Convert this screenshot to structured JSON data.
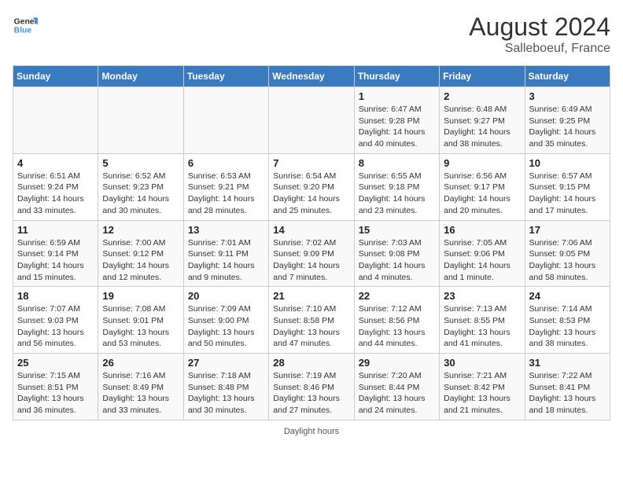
{
  "header": {
    "logo_general": "General",
    "logo_blue": "Blue",
    "month_year": "August 2024",
    "location": "Salleboeuf, France"
  },
  "days_of_week": [
    "Sunday",
    "Monday",
    "Tuesday",
    "Wednesday",
    "Thursday",
    "Friday",
    "Saturday"
  ],
  "weeks": [
    [
      {
        "day": "",
        "info": ""
      },
      {
        "day": "",
        "info": ""
      },
      {
        "day": "",
        "info": ""
      },
      {
        "day": "",
        "info": ""
      },
      {
        "day": "1",
        "info": "Sunrise: 6:47 AM\nSunset: 9:28 PM\nDaylight: 14 hours\nand 40 minutes."
      },
      {
        "day": "2",
        "info": "Sunrise: 6:48 AM\nSunset: 9:27 PM\nDaylight: 14 hours\nand 38 minutes."
      },
      {
        "day": "3",
        "info": "Sunrise: 6:49 AM\nSunset: 9:25 PM\nDaylight: 14 hours\nand 35 minutes."
      }
    ],
    [
      {
        "day": "4",
        "info": "Sunrise: 6:51 AM\nSunset: 9:24 PM\nDaylight: 14 hours\nand 33 minutes."
      },
      {
        "day": "5",
        "info": "Sunrise: 6:52 AM\nSunset: 9:23 PM\nDaylight: 14 hours\nand 30 minutes."
      },
      {
        "day": "6",
        "info": "Sunrise: 6:53 AM\nSunset: 9:21 PM\nDaylight: 14 hours\nand 28 minutes."
      },
      {
        "day": "7",
        "info": "Sunrise: 6:54 AM\nSunset: 9:20 PM\nDaylight: 14 hours\nand 25 minutes."
      },
      {
        "day": "8",
        "info": "Sunrise: 6:55 AM\nSunset: 9:18 PM\nDaylight: 14 hours\nand 23 minutes."
      },
      {
        "day": "9",
        "info": "Sunrise: 6:56 AM\nSunset: 9:17 PM\nDaylight: 14 hours\nand 20 minutes."
      },
      {
        "day": "10",
        "info": "Sunrise: 6:57 AM\nSunset: 9:15 PM\nDaylight: 14 hours\nand 17 minutes."
      }
    ],
    [
      {
        "day": "11",
        "info": "Sunrise: 6:59 AM\nSunset: 9:14 PM\nDaylight: 14 hours\nand 15 minutes."
      },
      {
        "day": "12",
        "info": "Sunrise: 7:00 AM\nSunset: 9:12 PM\nDaylight: 14 hours\nand 12 minutes."
      },
      {
        "day": "13",
        "info": "Sunrise: 7:01 AM\nSunset: 9:11 PM\nDaylight: 14 hours\nand 9 minutes."
      },
      {
        "day": "14",
        "info": "Sunrise: 7:02 AM\nSunset: 9:09 PM\nDaylight: 14 hours\nand 7 minutes."
      },
      {
        "day": "15",
        "info": "Sunrise: 7:03 AM\nSunset: 9:08 PM\nDaylight: 14 hours\nand 4 minutes."
      },
      {
        "day": "16",
        "info": "Sunrise: 7:05 AM\nSunset: 9:06 PM\nDaylight: 14 hours\nand 1 minute."
      },
      {
        "day": "17",
        "info": "Sunrise: 7:06 AM\nSunset: 9:05 PM\nDaylight: 13 hours\nand 58 minutes."
      }
    ],
    [
      {
        "day": "18",
        "info": "Sunrise: 7:07 AM\nSunset: 9:03 PM\nDaylight: 13 hours\nand 56 minutes."
      },
      {
        "day": "19",
        "info": "Sunrise: 7:08 AM\nSunset: 9:01 PM\nDaylight: 13 hours\nand 53 minutes."
      },
      {
        "day": "20",
        "info": "Sunrise: 7:09 AM\nSunset: 9:00 PM\nDaylight: 13 hours\nand 50 minutes."
      },
      {
        "day": "21",
        "info": "Sunrise: 7:10 AM\nSunset: 8:58 PM\nDaylight: 13 hours\nand 47 minutes."
      },
      {
        "day": "22",
        "info": "Sunrise: 7:12 AM\nSunset: 8:56 PM\nDaylight: 13 hours\nand 44 minutes."
      },
      {
        "day": "23",
        "info": "Sunrise: 7:13 AM\nSunset: 8:55 PM\nDaylight: 13 hours\nand 41 minutes."
      },
      {
        "day": "24",
        "info": "Sunrise: 7:14 AM\nSunset: 8:53 PM\nDaylight: 13 hours\nand 38 minutes."
      }
    ],
    [
      {
        "day": "25",
        "info": "Sunrise: 7:15 AM\nSunset: 8:51 PM\nDaylight: 13 hours\nand 36 minutes."
      },
      {
        "day": "26",
        "info": "Sunrise: 7:16 AM\nSunset: 8:49 PM\nDaylight: 13 hours\nand 33 minutes."
      },
      {
        "day": "27",
        "info": "Sunrise: 7:18 AM\nSunset: 8:48 PM\nDaylight: 13 hours\nand 30 minutes."
      },
      {
        "day": "28",
        "info": "Sunrise: 7:19 AM\nSunset: 8:46 PM\nDaylight: 13 hours\nand 27 minutes."
      },
      {
        "day": "29",
        "info": "Sunrise: 7:20 AM\nSunset: 8:44 PM\nDaylight: 13 hours\nand 24 minutes."
      },
      {
        "day": "30",
        "info": "Sunrise: 7:21 AM\nSunset: 8:42 PM\nDaylight: 13 hours\nand 21 minutes."
      },
      {
        "day": "31",
        "info": "Sunrise: 7:22 AM\nSunset: 8:41 PM\nDaylight: 13 hours\nand 18 minutes."
      }
    ]
  ],
  "footer": {
    "daylight_label": "Daylight hours"
  }
}
